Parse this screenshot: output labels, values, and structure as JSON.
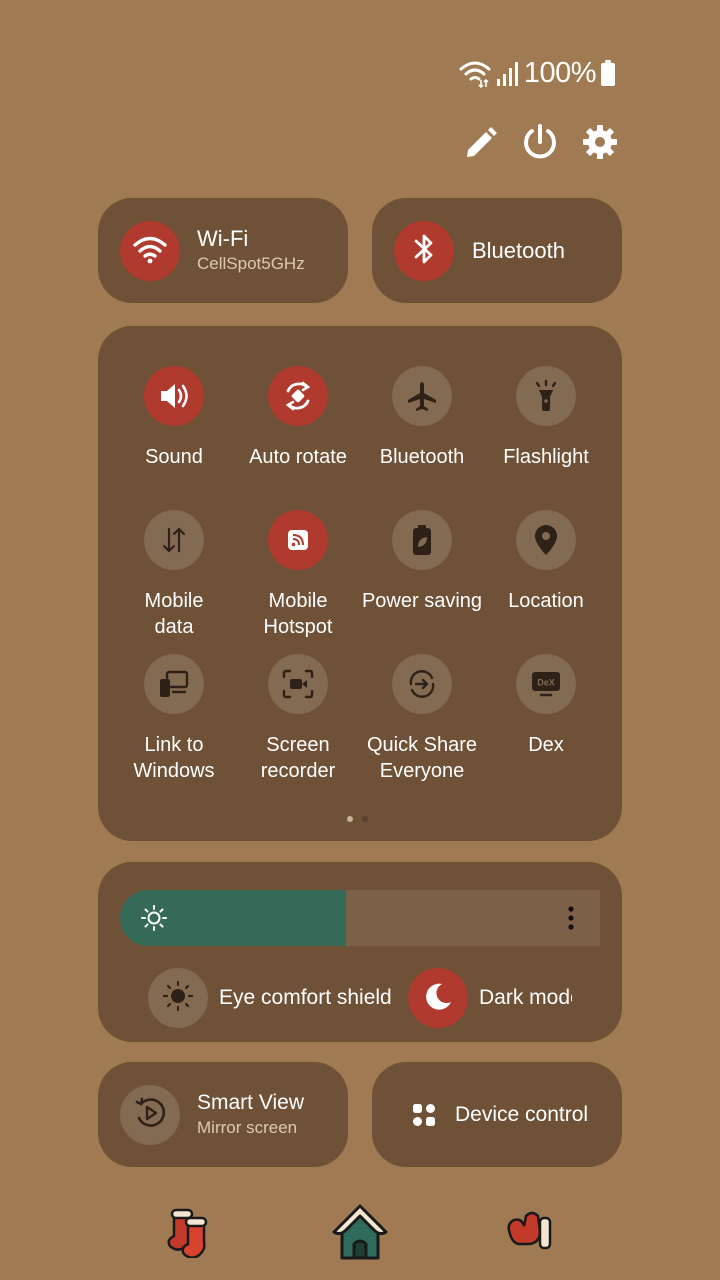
{
  "status_bar": {
    "battery": "100%"
  },
  "header": {
    "edit_icon": "pencil-icon",
    "power_icon": "power-icon",
    "settings_icon": "gear-icon"
  },
  "top_toggles": {
    "wifi": {
      "label": "Wi-Fi",
      "sub": "CellSpot5GHz",
      "state": "on"
    },
    "bluetooth": {
      "label": "Bluetooth",
      "state": "on"
    }
  },
  "tiles": [
    {
      "label": "Sound",
      "icon": "speaker-icon",
      "state": "on"
    },
    {
      "label": "Auto rotate",
      "icon": "rotate-icon",
      "state": "on"
    },
    {
      "label": "Bluetooth",
      "icon": "airplane-icon",
      "state": "off"
    },
    {
      "label": "Flashlight",
      "icon": "flashlight-icon",
      "state": "off"
    },
    {
      "label": "Mobile\ndata",
      "icon": "data-arrows-icon",
      "state": "off"
    },
    {
      "label": "Mobile\nHotspot",
      "icon": "hotspot-icon",
      "state": "on"
    },
    {
      "label": "Power saving",
      "icon": "battery-leaf-icon",
      "state": "off"
    },
    {
      "label": "Location",
      "icon": "location-pin-icon",
      "state": "off"
    },
    {
      "label": "Link to\nWindows",
      "icon": "link-windows-icon",
      "state": "off"
    },
    {
      "label": "Screen\nrecorder",
      "icon": "screen-recorder-icon",
      "state": "off"
    },
    {
      "label": "Quick Share\nEveryone",
      "icon": "quick-share-icon",
      "state": "off"
    },
    {
      "label": "Dex",
      "icon": "dex-icon",
      "state": "off"
    }
  ],
  "pager": {
    "pages": 2,
    "current": 1
  },
  "brightness": {
    "level": 0.47
  },
  "display_toggles": {
    "eye_comfort": {
      "label": "Eye comfort shield",
      "state": "off"
    },
    "dark_mode": {
      "label": "Dark mode",
      "state": "on"
    }
  },
  "bottom": {
    "smart_view": {
      "label": "Smart View",
      "sub": "Mirror screen"
    },
    "device_control": {
      "label": "Device control"
    }
  },
  "dock": [
    "boots-icon",
    "house-icon",
    "mitten-icon"
  ],
  "colors": {
    "background": "#a07a52",
    "panel": "#6e5136",
    "accent_on": "#b03a2e",
    "brightness": "#356a59"
  }
}
